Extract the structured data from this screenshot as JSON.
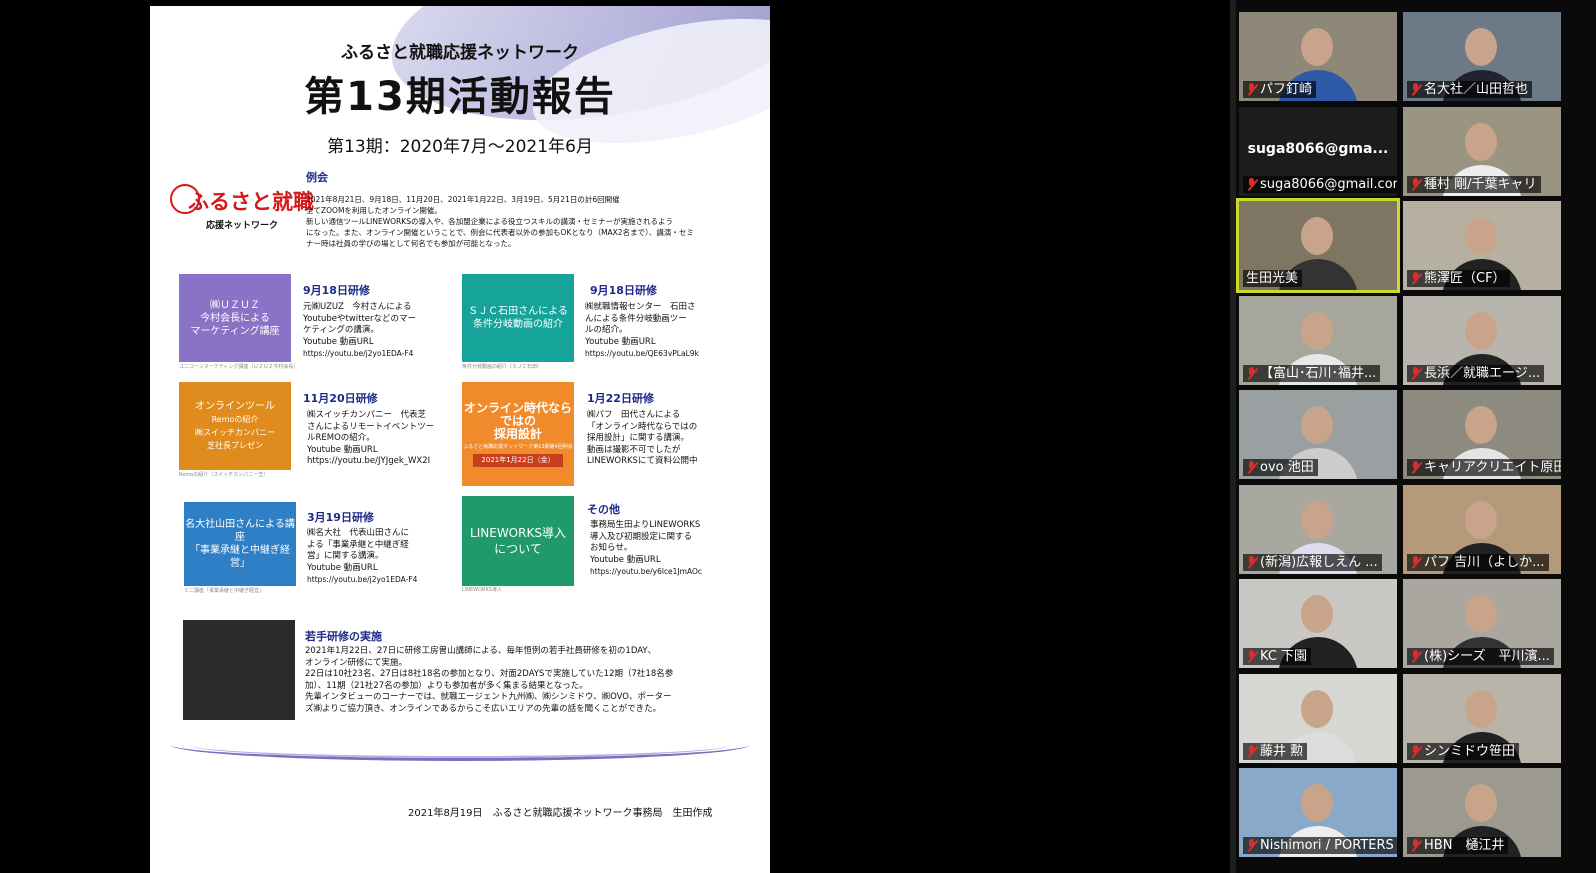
{
  "document": {
    "org": "ふるさと就職応援ネットワーク",
    "title": "第13期活動報告",
    "period": "第13期：2020年7月～2021年6月",
    "logo": {
      "main": "ふるさと就職",
      "sub": "応援ネットワーク"
    },
    "meeting": {
      "heading": "例会",
      "lines": [
        "2021年8月21日、9月18日、11月20日、2021年1月22日、3月19日、5月21日の計6回開催",
        "全てZOOMを利用したオンライン開催。",
        "新しい通信ツールLINEWORKSの導入や、各加盟企業による役立つスキルの講演・セミナーが実施されるよう",
        "になった。また、オンライン開催ということで、例会に代表者以外の参加もOKとなり（MAX2名まで）、講演・セミ",
        "ナー時は社員の学びの場として何名でも参加が可能となった。"
      ]
    },
    "sections": [
      {
        "heading": "9月18日研修",
        "thumb": [
          "㈱ＵＺＵＺ",
          "今村会長による",
          "マーケティング講座"
        ],
        "caption": "ユニコーンマーケティング講座（ＵＺＵＺ今村会長）",
        "lines": [
          "元㈱UZUZ　今村さんによる",
          "Youtubeやtwitterなどのマー",
          "ケティングの講演。",
          "Youtube 動画URL",
          "https://youtu.be/j2yo1EDA-F4"
        ]
      },
      {
        "heading": "9月18日研修",
        "thumb": [
          "ＳＪＣ石田さんによる",
          "条件分岐動画の紹介"
        ],
        "caption": "条件分岐動画の紹介（ＳＪＣ石田）",
        "lines": [
          "㈱就職情報センター　石田さ",
          "んによる条件分岐動画ツー",
          "ルの紹介。",
          "Youtube 動画URL",
          "https://youtu.be/QE63vPLaL9k"
        ]
      },
      {
        "heading": "11月20日研修",
        "thumb": [
          "オンラインツール",
          "Remoの紹介",
          "㈱スイッチカンパニー",
          "芝社長プレゼン"
        ],
        "caption": "Remoの紹介（スイッチカンパニー芝）",
        "lines": [
          "㈱スイッチカンパニー　代表芝",
          "さんによるリモートイベントツー",
          "ルREMOの紹介。",
          "Youtube 動画URL",
          "https://youtu.be/JYJgek_WX2I"
        ]
      },
      {
        "heading": "1月22日研修",
        "thumb": [
          "オンライン時代ならではの",
          "採用設計",
          "ふるさと就職応援ネットワーク第13期第4回例会",
          "2021年1月22日（金）"
        ],
        "caption": "",
        "lines": [
          "㈱パフ　田代さんによる",
          "「オンライン時代ならではの",
          "採用設計」に関する講演。",
          "動画は撮影不可でしたが",
          "LINEWORKSにて資料公開中"
        ]
      },
      {
        "heading": "3月19日研修",
        "thumb": [
          "名大社山田さんによる講座",
          "「事業承継と中継ぎ経営」"
        ],
        "caption": "ミニ講座「事業承継と中継ぎ経営」",
        "lines": [
          "㈱名大社　代表山田さんに",
          "よる「事業承継と中継ぎ経",
          "営」に関する講演。",
          "Youtube 動画URL",
          "https://youtu.be/j2yo1EDA-F4"
        ]
      },
      {
        "heading": "その他",
        "thumb": [
          "LINEWORKS導入",
          "について"
        ],
        "caption": "LINEWORKS導入",
        "lines": [
          "事務局生田よりLINEWORKS",
          "導入及び初期設定に関する",
          "お知らせ。",
          "Youtube 動画URL",
          "https://youtu.be/y6lce1JmAOc"
        ]
      }
    ],
    "training": {
      "heading": "若手研修の実施",
      "lines": [
        "2021年1月22日、27日に研修工房曽山講師による、毎年恒例の若手社員研修を初の1DAY、",
        "オンライン研修にて実施。",
        "22日は10社23名、27日は8社18名の参加となり、対面2DAYSで実施していた12期（7社18名参",
        "加）、11期（21社27名の参加）よりも参加者が多く集まる結果となった。",
        "先輩インタビューのコーナーでは、就職エージェント九州㈱、㈱シンミドウ、㈱OVO、ポーター",
        "ズ㈱よりご協力頂き、オンラインであるからこそ広いエリアの先輩の話を聞くことができた。"
      ]
    },
    "footer": "2021年8月19日　ふるさと就職応援ネットワーク事務局　生田作成"
  },
  "participants": [
    {
      "name": "パフ釘崎",
      "muted": true
    },
    {
      "name": "名大社／山田哲也",
      "muted": true
    },
    {
      "name": "suga8066@gmail.com",
      "display": "suga8066@gma...",
      "muted": true,
      "video": false
    },
    {
      "name": "種村 剛/千葉キャリ",
      "muted": true
    },
    {
      "name": "生田光美",
      "muted": false,
      "speaking": true
    },
    {
      "name": "熊澤匠（CF）",
      "muted": true
    },
    {
      "name": "【富山･石川･福井...",
      "muted": true
    },
    {
      "name": "長浜／就職エージ...",
      "muted": true
    },
    {
      "name": "ovo 池田",
      "muted": true
    },
    {
      "name": "キャリアクリエイト原田",
      "muted": true
    },
    {
      "name": "(新潟)広報しえん ...",
      "muted": true
    },
    {
      "name": "パフ 吉川（よしか...",
      "muted": true
    },
    {
      "name": "KC 下園",
      "muted": true
    },
    {
      "name": "(株)シーズ　平川濱...",
      "muted": true
    },
    {
      "name": "藤井 勲",
      "muted": true
    },
    {
      "name": "シンミドウ笹田",
      "muted": true
    },
    {
      "name": "Nishimori / PORTERS",
      "muted": true
    },
    {
      "name": "HBN　樋江井",
      "muted": true
    }
  ]
}
